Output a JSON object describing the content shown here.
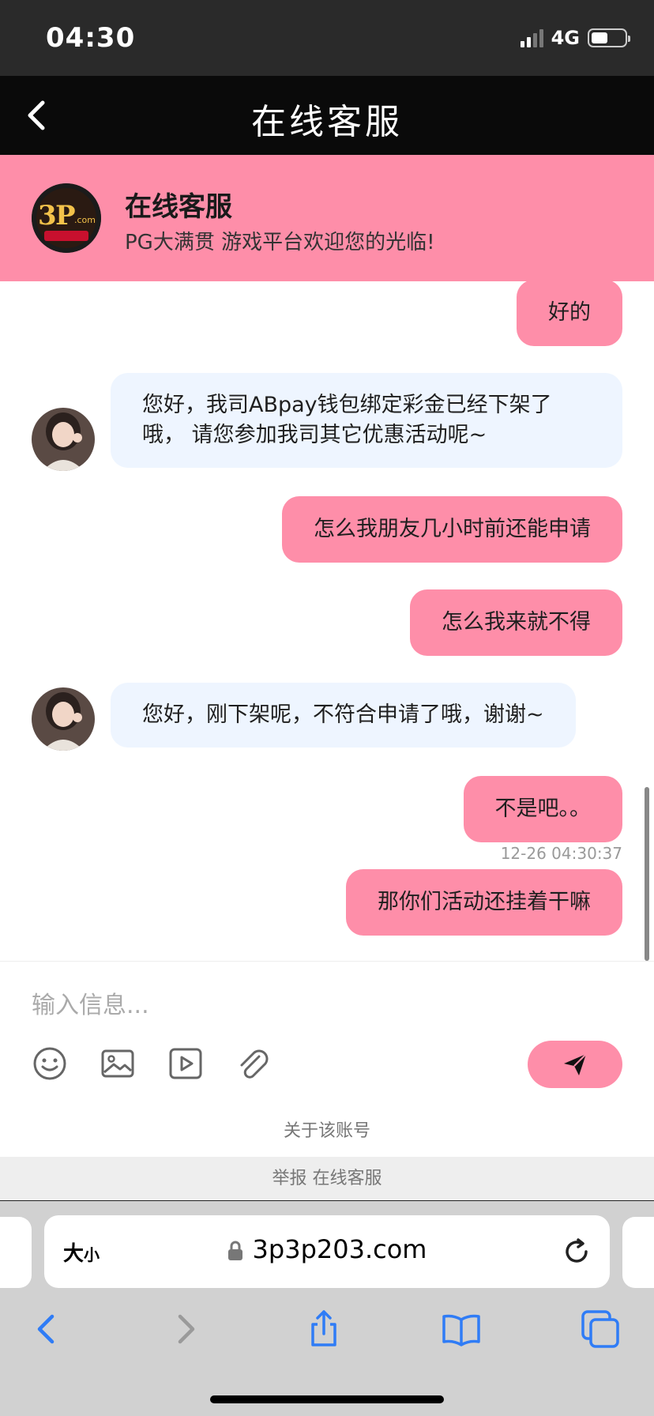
{
  "status_bar": {
    "time": "04:30",
    "network": "4G"
  },
  "nav": {
    "title": "在线客服"
  },
  "chat_header": {
    "name": "在线客服",
    "subtitle": "PG大满贯 游戏平台欢迎您的光临!"
  },
  "messages": [
    {
      "side": "out",
      "text": "好的"
    },
    {
      "side": "in",
      "text": "您好，我司ABpay钱包绑定彩金已经下架了哦， 请您参加我司其它优惠活动呢~"
    },
    {
      "side": "out",
      "text": "怎么我朋友几小时前还能申请"
    },
    {
      "side": "out",
      "text": "怎么我来就不得"
    },
    {
      "side": "in",
      "text": "您好，刚下架呢，不符合申请了哦，谢谢~"
    },
    {
      "side": "out",
      "text": "不是吧。。"
    },
    {
      "side": "out",
      "text": "那你们活动还挂着干嘛",
      "timestamp": "12-26 04:30:37"
    }
  ],
  "composer": {
    "placeholder": "输入信息...",
    "about_link": "关于该账号"
  },
  "report_bar": {
    "text": "举报 在线客服"
  },
  "browser": {
    "text_size_label": "大",
    "text_size_small": "小",
    "url": "3p3p203.com"
  },
  "colors": {
    "accent": "#fe8ea9",
    "incoming_bubble": "#eef5ff",
    "nav_bg": "#0a0a0a"
  }
}
